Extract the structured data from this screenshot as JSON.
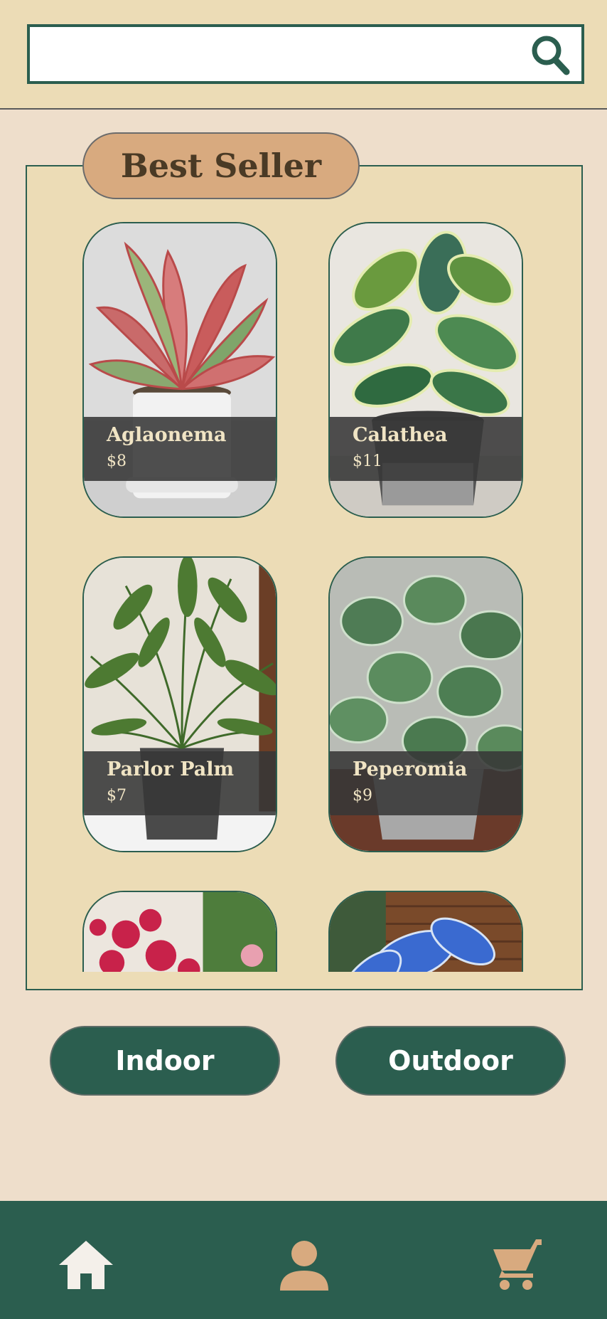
{
  "search": {
    "placeholder": "",
    "value": "",
    "icon": "search-icon"
  },
  "section": {
    "title": "Best Seller"
  },
  "products": [
    {
      "name": "Aglaonema",
      "price": "$8"
    },
    {
      "name": "Calathea",
      "price": "$11"
    },
    {
      "name": "Parlor Palm",
      "price": "$7"
    },
    {
      "name": "Peperomia",
      "price": "$9"
    },
    {
      "name": "",
      "price": ""
    },
    {
      "name": "",
      "price": ""
    }
  ],
  "categories": {
    "indoor": "Indoor",
    "outdoor": "Outdoor"
  },
  "nav": {
    "home_icon": "home-icon",
    "profile_icon": "person-icon",
    "cart_icon": "cart-icon"
  },
  "colors": {
    "primary": "#2b5e4f",
    "accent": "#d8aa7f",
    "panel": "#ecdcb6",
    "background": "#eedecb",
    "caption_text": "#f0e4c4",
    "nav_home": "#f4f0ea",
    "nav_profile": "#d8aa7f",
    "nav_cart": "#d8aa7f"
  }
}
